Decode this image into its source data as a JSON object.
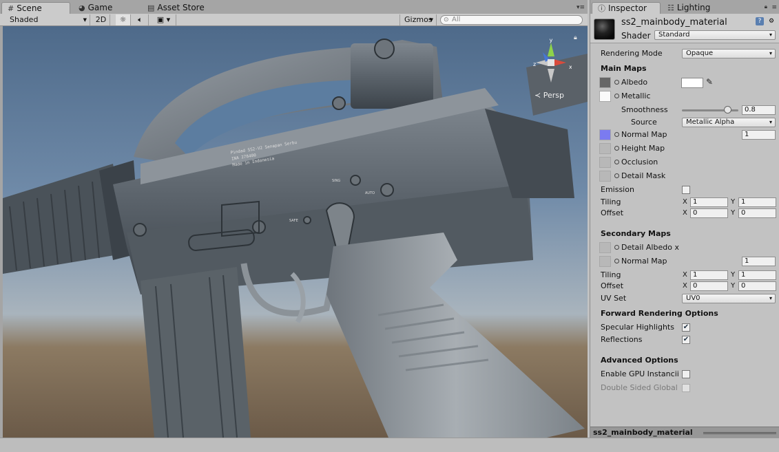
{
  "scene_tabs": [
    {
      "label": "Scene",
      "icon": "hash-icon"
    },
    {
      "label": "Game",
      "icon": "pacman-icon"
    },
    {
      "label": "Asset Store",
      "icon": "store-icon"
    }
  ],
  "scene_toolbar": {
    "draw_mode": "Shaded",
    "mode_2d": "2D",
    "gizmos": "Gizmos",
    "search_placeholder": "All"
  },
  "viewport": {
    "projection_label": "Persp",
    "gizmo_axes": {
      "x": "x",
      "y": "y",
      "z": "z"
    },
    "gun_engraving": [
      "Pindad SS2-V2 Senapan Serbu",
      "INA 278400",
      "Made in Indonesia"
    ],
    "selector_marks": {
      "safe": "SAFE",
      "single": "SING",
      "auto": "AUTO"
    }
  },
  "inspector_tabs": [
    {
      "label": "Inspector",
      "icon": "info-icon"
    },
    {
      "label": "Lighting",
      "icon": "lighting-icon"
    }
  ],
  "material": {
    "name": "ss2_mainbody_material",
    "shader_label": "Shader",
    "shader_value": "Standard"
  },
  "props": {
    "rendering_mode_label": "Rendering Mode",
    "rendering_mode_value": "Opaque",
    "main_maps_header": "Main Maps",
    "albedo": "Albedo",
    "albedo_color": "#ffffff",
    "metallic": "Metallic",
    "smoothness": "Smoothness",
    "smoothness_value": "0.8",
    "smoothness_level": 0.8,
    "source": "Source",
    "source_value": "Metallic Alpha",
    "normal_map": "Normal Map",
    "normal_map_value": "1",
    "height_map": "Height Map",
    "occlusion": "Occlusion",
    "detail_mask": "Detail Mask",
    "emission": "Emission",
    "tiling": "Tiling",
    "offset": "Offset",
    "x": "X",
    "y": "Y",
    "tiling_x": "1",
    "tiling_y": "1",
    "offset_x": "0",
    "offset_y": "0",
    "secondary_maps_header": "Secondary Maps",
    "detail_albedo": "Detail Albedo x",
    "sec_normal_map": "Normal Map",
    "sec_normal_value": "1",
    "sec_tiling_x": "1",
    "sec_tiling_y": "1",
    "sec_offset_x": "0",
    "sec_offset_y": "0",
    "uv_set": "UV Set",
    "uv_set_value": "UV0",
    "forward_header": "Forward Rendering Options",
    "specular_highlights": "Specular Highlights",
    "reflections": "Reflections",
    "advanced_header": "Advanced Options",
    "gpu_instancing": "Enable GPU Instancii",
    "double_sided": "Double Sided Global"
  },
  "footer_name": "ss2_mainbody_material",
  "colors": {
    "normal_map_thumb": "#7b7bf0",
    "sky_top": "#4e6a8a",
    "ground": "#6b5a48"
  }
}
